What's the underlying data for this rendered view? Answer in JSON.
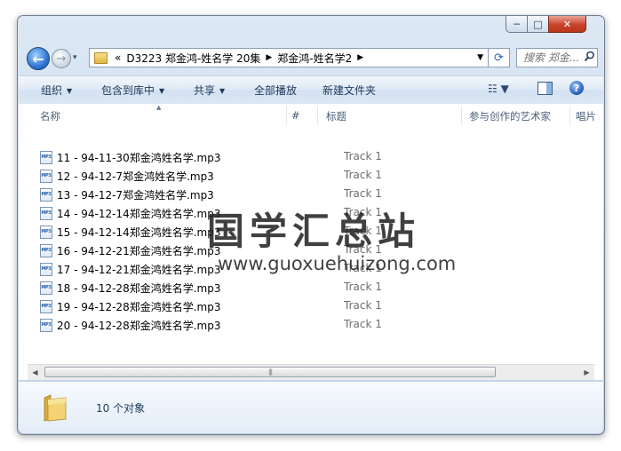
{
  "window": {
    "caption_buttons": {
      "minimize": "─",
      "maximize": "□",
      "close": "✕"
    }
  },
  "nav": {
    "back_glyph": "←",
    "forward_glyph": "→",
    "recent_glyph": "▾"
  },
  "address": {
    "chevron": "«",
    "crumbs": [
      "D3223 郑金鸿-姓名学 20集",
      "郑金鸿-姓名学2"
    ],
    "separator": "▶",
    "dropdown_glyph": "▼",
    "refresh_glyph": "⟳"
  },
  "search": {
    "placeholder": "搜索 郑金...",
    "icon": "search-icon"
  },
  "toolbar": {
    "organize": "组织",
    "include_in_library": "包含到库中",
    "share": "共享",
    "play_all": "全部播放",
    "new_folder": "新建文件夹",
    "caret": "▼",
    "view_glyph": "☷ ▼",
    "help_glyph": "?"
  },
  "columns": {
    "name": "名称",
    "number": "#",
    "title": "标题",
    "contributing_artists": "参与创作的艺术家",
    "album": "唱片"
  },
  "files": [
    {
      "name": "11 - 94-11-30郑金鸿姓名学.mp3",
      "title": "Track 1"
    },
    {
      "name": "12 - 94-12-7郑金鸿姓名学.mp3",
      "title": "Track 1"
    },
    {
      "name": "13 - 94-12-7郑金鸿姓名学.mp3",
      "title": "Track 1"
    },
    {
      "name": "14 - 94-12-14郑金鸿姓名学.mp3",
      "title": "Track 1"
    },
    {
      "name": "15 - 94-12-14郑金鸿姓名学.mp3",
      "title": "Track 1"
    },
    {
      "name": "16 - 94-12-21郑金鸿姓名学.mp3",
      "title": "Track 1"
    },
    {
      "name": "17 - 94-12-21郑金鸿姓名学.mp3",
      "title": "Track 1"
    },
    {
      "name": "18 - 94-12-28郑金鸿姓名学.mp3",
      "title": "Track 1"
    },
    {
      "name": "19 - 94-12-28郑金鸿姓名学.mp3",
      "title": "Track 1"
    },
    {
      "name": "20 - 94-12-28郑金鸿姓名学.mp3",
      "title": "Track 1"
    }
  ],
  "file_icon_label": "MP3",
  "watermark": {
    "chinese": "国学汇总站",
    "url": "www.guoxuehuizong.com"
  },
  "scrollbar": {
    "left": "◀",
    "right": "▶",
    "grip": "|||"
  },
  "status": {
    "item_count": "10 个对象"
  },
  "colors": {
    "accent": "#1e395b",
    "frame": "#c9d9ec",
    "close_button": "#c7452d"
  }
}
